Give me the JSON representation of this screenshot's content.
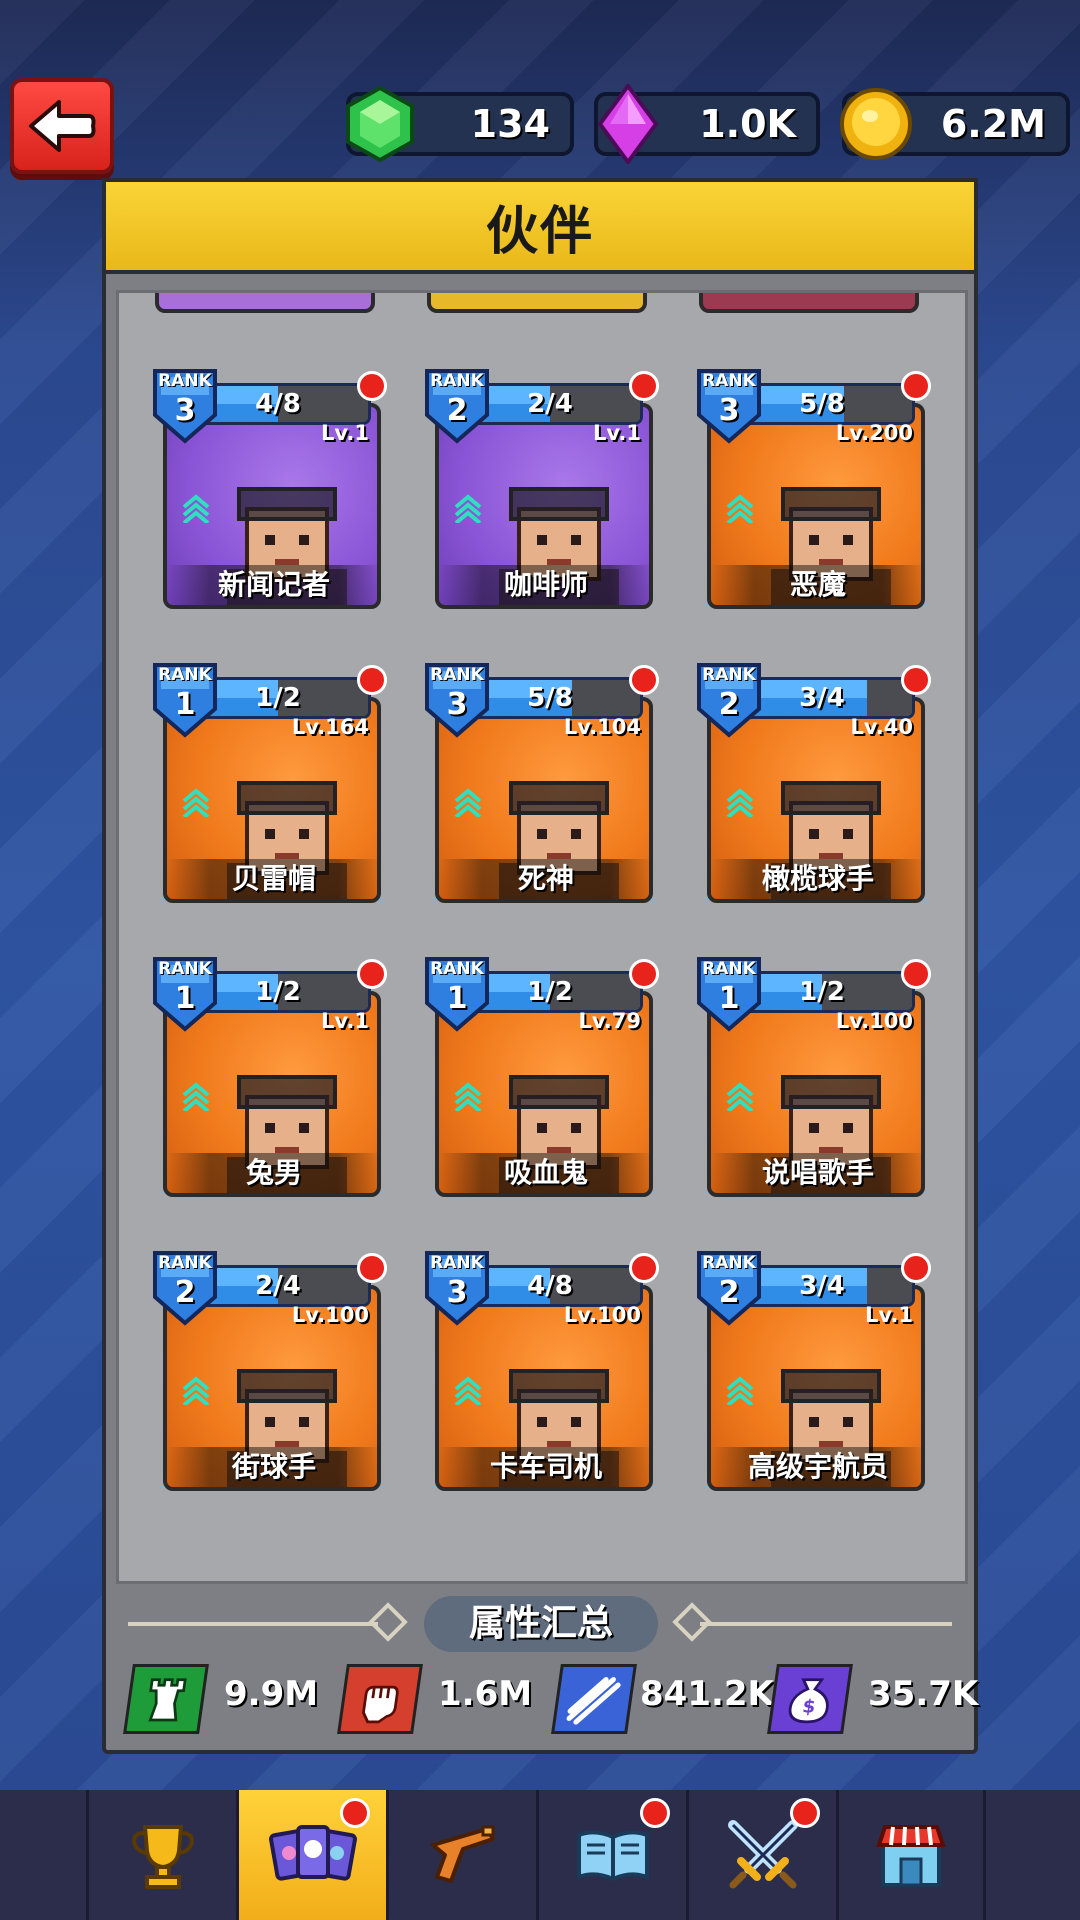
{
  "header": {
    "currencies": [
      {
        "icon": "green-gem-icon",
        "value": "134"
      },
      {
        "icon": "purple-diamond-icon",
        "value": "1.0K"
      },
      {
        "icon": "gold-coin-icon",
        "value": "6.2M"
      }
    ]
  },
  "panel": {
    "title": "伙伴"
  },
  "companions": [
    {
      "rank": "3",
      "rank_label": "RANK",
      "progress": "4/8",
      "progress_fraction": 0.5,
      "level": "Lv.1",
      "name": "新闻记者",
      "bg": "purple"
    },
    {
      "rank": "2",
      "rank_label": "RANK",
      "progress": "2/4",
      "progress_fraction": 0.5,
      "level": "Lv.1",
      "name": "咖啡师",
      "bg": "purple"
    },
    {
      "rank": "3",
      "rank_label": "RANK",
      "progress": "5/8",
      "progress_fraction": 0.625,
      "level": "Lv.200",
      "name": "恶魔",
      "bg": "orange"
    },
    {
      "rank": "1",
      "rank_label": "RANK",
      "progress": "1/2",
      "progress_fraction": 0.5,
      "level": "Lv.164",
      "name": "贝雷帽",
      "bg": "orange"
    },
    {
      "rank": "3",
      "rank_label": "RANK",
      "progress": "5/8",
      "progress_fraction": 0.625,
      "level": "Lv.104",
      "name": "死神",
      "bg": "orange"
    },
    {
      "rank": "2",
      "rank_label": "RANK",
      "progress": "3/4",
      "progress_fraction": 0.75,
      "level": "Lv.40",
      "name": "橄榄球手",
      "bg": "orange"
    },
    {
      "rank": "1",
      "rank_label": "RANK",
      "progress": "1/2",
      "progress_fraction": 0.5,
      "level": "Lv.1",
      "name": "兔男",
      "bg": "orange"
    },
    {
      "rank": "1",
      "rank_label": "RANK",
      "progress": "1/2",
      "progress_fraction": 0.5,
      "level": "Lv.79",
      "name": "吸血鬼",
      "bg": "orange"
    },
    {
      "rank": "1",
      "rank_label": "RANK",
      "progress": "1/2",
      "progress_fraction": 0.5,
      "level": "Lv.100",
      "name": "说唱歌手",
      "bg": "orange"
    },
    {
      "rank": "2",
      "rank_label": "RANK",
      "progress": "2/4",
      "progress_fraction": 0.5,
      "level": "Lv.100",
      "name": "街球手",
      "bg": "orange"
    },
    {
      "rank": "3",
      "rank_label": "RANK",
      "progress": "4/8",
      "progress_fraction": 0.5,
      "level": "Lv.100",
      "name": "卡车司机",
      "bg": "orange"
    },
    {
      "rank": "2",
      "rank_label": "RANK",
      "progress": "3/4",
      "progress_fraction": 0.75,
      "level": "Lv.1",
      "name": "高级宇航员",
      "bg": "orange"
    }
  ],
  "summary": {
    "title": "属性汇总",
    "stats": [
      {
        "icon": "tower-icon",
        "value": "9.9M",
        "color": "#1f9c3a"
      },
      {
        "icon": "fist-icon",
        "value": "1.6M",
        "color": "#d5402e"
      },
      {
        "icon": "auto-blades-icon",
        "value": "841.2K",
        "color": "#3b63d8"
      },
      {
        "icon": "money-bag-icon",
        "value": "35.7K",
        "color": "#6a40d4"
      }
    ]
  },
  "nav": [
    {
      "icon": "trophy-icon",
      "active": false,
      "badge": false
    },
    {
      "icon": "companions-icon",
      "active": true,
      "badge": true
    },
    {
      "icon": "pistol-icon",
      "active": false,
      "badge": false
    },
    {
      "icon": "book-icon",
      "active": false,
      "badge": true
    },
    {
      "icon": "crossed-swords-icon",
      "active": false,
      "badge": true
    },
    {
      "icon": "shop-icon",
      "active": false,
      "badge": false
    }
  ]
}
